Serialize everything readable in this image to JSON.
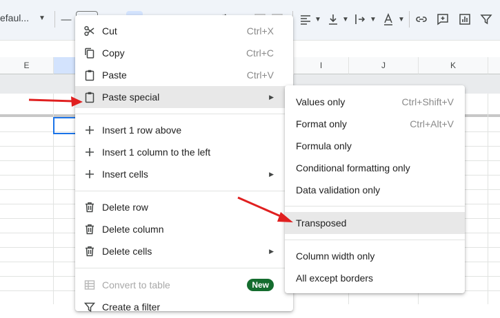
{
  "toolbar": {
    "font_name": "efaul...",
    "icons": [
      "minus-icon",
      "font-size-box",
      "bold-icon",
      "italic-icon",
      "strikethrough-icon",
      "text-color-icon",
      "paint-format-icon",
      "borders-icon",
      "merge-icon",
      "align-left-icon",
      "valign-bottom-icon",
      "text-wrap-icon",
      "text-rotate-icon",
      "link-icon",
      "comment-icon",
      "chart-icon",
      "filter-icon"
    ]
  },
  "sheet": {
    "columns": [
      "E",
      "I",
      "J",
      "K"
    ]
  },
  "menu": {
    "items": [
      {
        "label": "Cut",
        "shortcut": "Ctrl+X",
        "icon": "cut-icon"
      },
      {
        "label": "Copy",
        "shortcut": "Ctrl+C",
        "icon": "copy-icon"
      },
      {
        "label": "Paste",
        "shortcut": "Ctrl+V",
        "icon": "paste-icon"
      },
      {
        "label": "Paste special",
        "icon": "paste-special-icon"
      },
      {
        "label": "Insert 1 row above",
        "icon": "plus-icon"
      },
      {
        "label": "Insert 1 column to the left",
        "icon": "plus-icon"
      },
      {
        "label": "Insert cells",
        "icon": "plus-icon"
      },
      {
        "label": "Delete row",
        "icon": "trash-icon"
      },
      {
        "label": "Delete column",
        "icon": "trash-icon"
      },
      {
        "label": "Delete cells",
        "icon": "trash-icon"
      },
      {
        "label": "Convert to table",
        "badge": "New",
        "icon": "table-icon"
      },
      {
        "label": "Create a filter",
        "icon": "filter-icon"
      }
    ]
  },
  "submenu": {
    "items": [
      {
        "label": "Values only",
        "shortcut": "Ctrl+Shift+V"
      },
      {
        "label": "Format only",
        "shortcut": "Ctrl+Alt+V"
      },
      {
        "label": "Formula only"
      },
      {
        "label": "Conditional formatting only"
      },
      {
        "label": "Data validation only"
      },
      {
        "label": "Transposed"
      },
      {
        "label": "Column width only"
      },
      {
        "label": "All except borders"
      }
    ]
  },
  "colors": {
    "highlight": "#e8e8e8",
    "new_badge": "#146c2e",
    "annotation_arrow": "#e02020",
    "selection": "#1a73e8"
  }
}
